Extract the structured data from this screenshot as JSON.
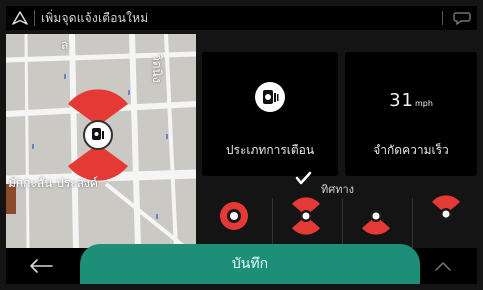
{
  "header": {
    "title": "เพิ่มจุดแจ้งเตือนใหม่",
    "nav_icon": "navigation-arrow-icon",
    "chat_icon": "speech-bubble-icon"
  },
  "map": {
    "street_labels": [
      "ล",
      "วิดนิง",
      "มักกะสัน ประสงค์"
    ]
  },
  "alert_type": {
    "label": "ประเภทการเตือน",
    "icon": "speed-camera-icon"
  },
  "speed_limit": {
    "value": "31",
    "unit": "mph",
    "label": "จำกัดความเร็ว"
  },
  "direction": {
    "label": "ทิศทาง",
    "options": [
      {
        "id": "all",
        "selected": false
      },
      {
        "id": "both",
        "selected": true
      },
      {
        "id": "forward",
        "selected": false
      },
      {
        "id": "backward",
        "selected": false
      }
    ]
  },
  "footer": {
    "save_label": "บันทึก",
    "back_icon": "back-arrow-icon",
    "up_icon": "chevron-up-icon"
  },
  "colors": {
    "accent": "#1d8f78",
    "alert_red": "#e53935"
  }
}
